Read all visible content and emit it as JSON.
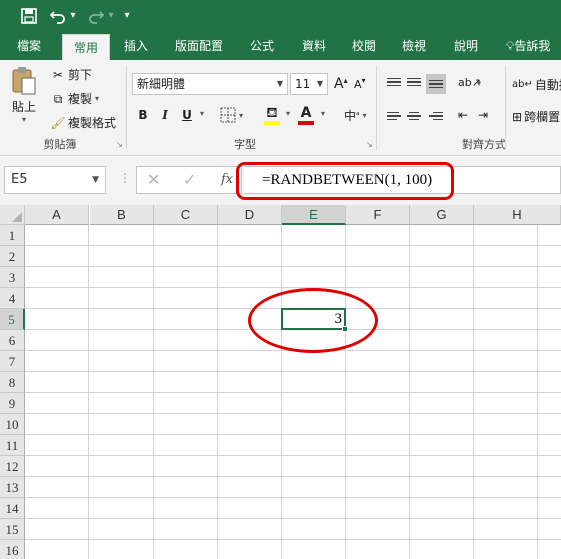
{
  "quick_access": {
    "save_icon": "save-icon",
    "undo_icon": "undo-icon",
    "redo_icon": "redo-icon",
    "customize_icon": "customize-qat-icon"
  },
  "tabs": [
    {
      "label": "檔案"
    },
    {
      "label": "常用"
    },
    {
      "label": "插入"
    },
    {
      "label": "版面配置"
    },
    {
      "label": "公式"
    },
    {
      "label": "資料"
    },
    {
      "label": "校閱"
    },
    {
      "label": "檢視"
    },
    {
      "label": "說明"
    }
  ],
  "tell_me": "告訴我",
  "ribbon": {
    "clipboard": {
      "paste": "貼上",
      "cut": "剪下",
      "copy": "複製",
      "format_painter": "複製格式",
      "group_label": "剪貼簿"
    },
    "font": {
      "font_name": "新細明體",
      "font_size": "11",
      "grow": "A",
      "shrink": "A",
      "bold": "B",
      "italic": "I",
      "underline": "U",
      "font_color_letter": "A",
      "phonetic": "中",
      "group_label": "字型"
    },
    "alignment": {
      "wrap_text": "自動換",
      "merge": "跨欄置",
      "group_label": "對齊方式"
    }
  },
  "formula_bar": {
    "name_box": "E5",
    "fx": "fx",
    "formula": "=RANDBETWEEN(1, 100)"
  },
  "grid": {
    "columns": [
      "A",
      "B",
      "C",
      "D",
      "E",
      "F",
      "G",
      "H"
    ],
    "rows": [
      "1",
      "2",
      "3",
      "4",
      "5",
      "6",
      "7",
      "8",
      "9",
      "10",
      "11",
      "12",
      "13",
      "14",
      "15",
      "16"
    ],
    "selected_column": "E",
    "selected_row": "5",
    "active_cell_value": "3"
  },
  "colors": {
    "brand_green": "#217346",
    "annotation_red": "#e00000"
  }
}
